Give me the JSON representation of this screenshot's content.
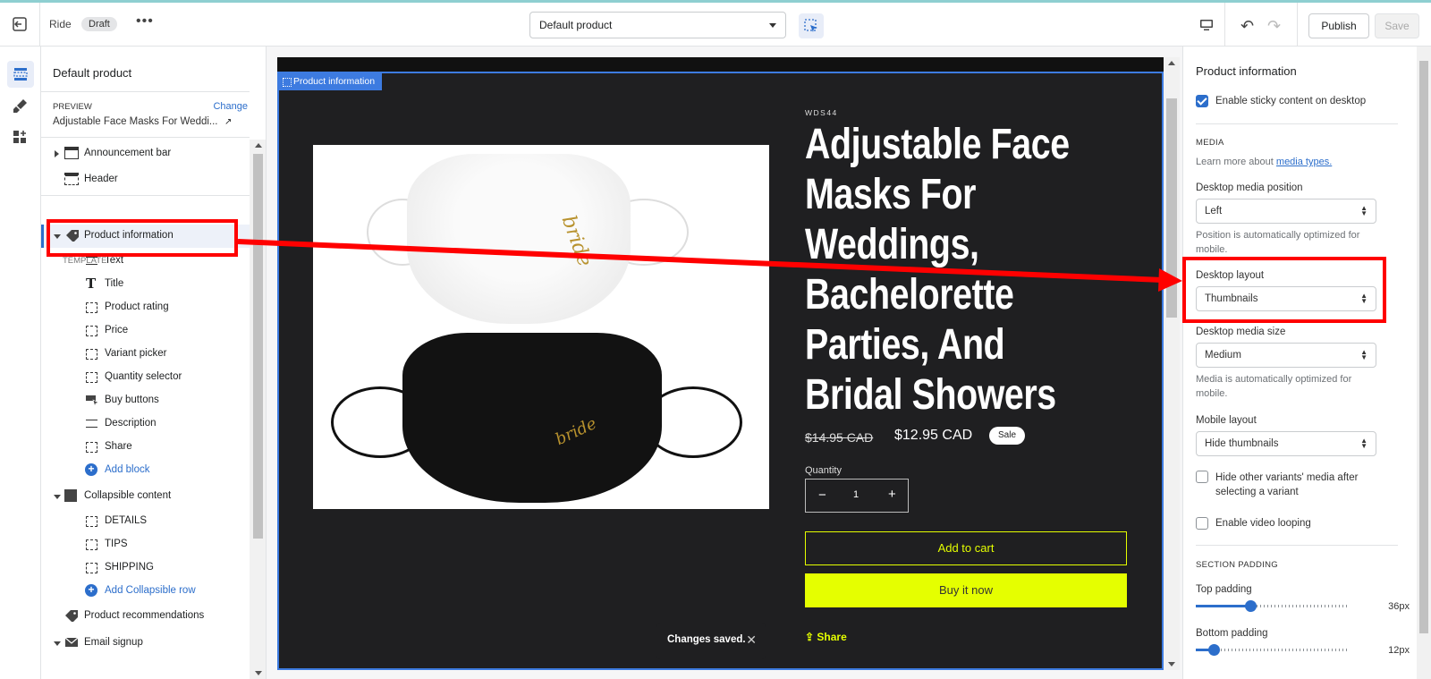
{
  "topbar": {
    "theme_name": "Ride",
    "status_badge": "Draft",
    "more_label": "•••",
    "template_select": "Default product",
    "publish_label": "Publish",
    "save_label": "Save"
  },
  "sidebar": {
    "title": "Default product",
    "preview_label": "PREVIEW",
    "change_label": "Change",
    "preview_value": "Adjustable Face Masks For Weddi...",
    "items": {
      "announcement_bar": "Announcement bar",
      "header": "Header",
      "template_label": "TEMPLATE",
      "product_information": "Product information",
      "text": "Text",
      "title": "Title",
      "product_rating": "Product rating",
      "price": "Price",
      "variant_picker": "Variant picker",
      "quantity_selector": "Quantity selector",
      "buy_buttons": "Buy buttons",
      "description": "Description",
      "share": "Share",
      "add_block": "Add block",
      "collapsible_content": "Collapsible content",
      "details": "DETAILS",
      "tips": "TIPS",
      "shipping": "SHIPPING",
      "add_collapsible_row": "Add Collapsible row",
      "product_recommendations": "Product recommendations",
      "email_signup": "Email signup"
    }
  },
  "preview": {
    "section_tag": "Product information",
    "vendor": "WDS44",
    "product_title": "Adjustable Face Masks For Weddings, Bachelorette Parties, And Bridal Showers",
    "price_old": "$14.95 CAD",
    "price_new": "$12.95 CAD",
    "sale_badge": "Sale",
    "quantity_label": "Quantity",
    "quantity_value": "1",
    "add_to_cart": "Add to cart",
    "buy_now": "Buy it now",
    "share": "Share",
    "toast": "Changes saved.",
    "mask_script": "bride",
    "accent_color": "#e5ff00"
  },
  "settings": {
    "title": "Product information",
    "sticky_label": "Enable sticky content on desktop",
    "sticky_checked": true,
    "media_header": "MEDIA",
    "media_help_prefix": "Learn more about",
    "media_help_link": "media types.",
    "desktop_media_position_label": "Desktop media position",
    "desktop_media_position_value": "Left",
    "position_help": "Position is automatically optimized for mobile.",
    "desktop_layout_label": "Desktop layout",
    "desktop_layout_value": "Thumbnails",
    "desktop_media_size_label": "Desktop media size",
    "desktop_media_size_value": "Medium",
    "media_help2": "Media is automatically optimized for mobile.",
    "mobile_layout_label": "Mobile layout",
    "mobile_layout_value": "Hide thumbnails",
    "hide_variants_label": "Hide other variants' media after selecting a variant",
    "video_looping_label": "Enable video looping",
    "section_padding_header": "SECTION PADDING",
    "top_padding_label": "Top padding",
    "top_padding_value": "36px",
    "top_padding_fraction": 0.36,
    "bottom_padding_label": "Bottom padding",
    "bottom_padding_value": "12px",
    "bottom_padding_fraction": 0.12
  }
}
